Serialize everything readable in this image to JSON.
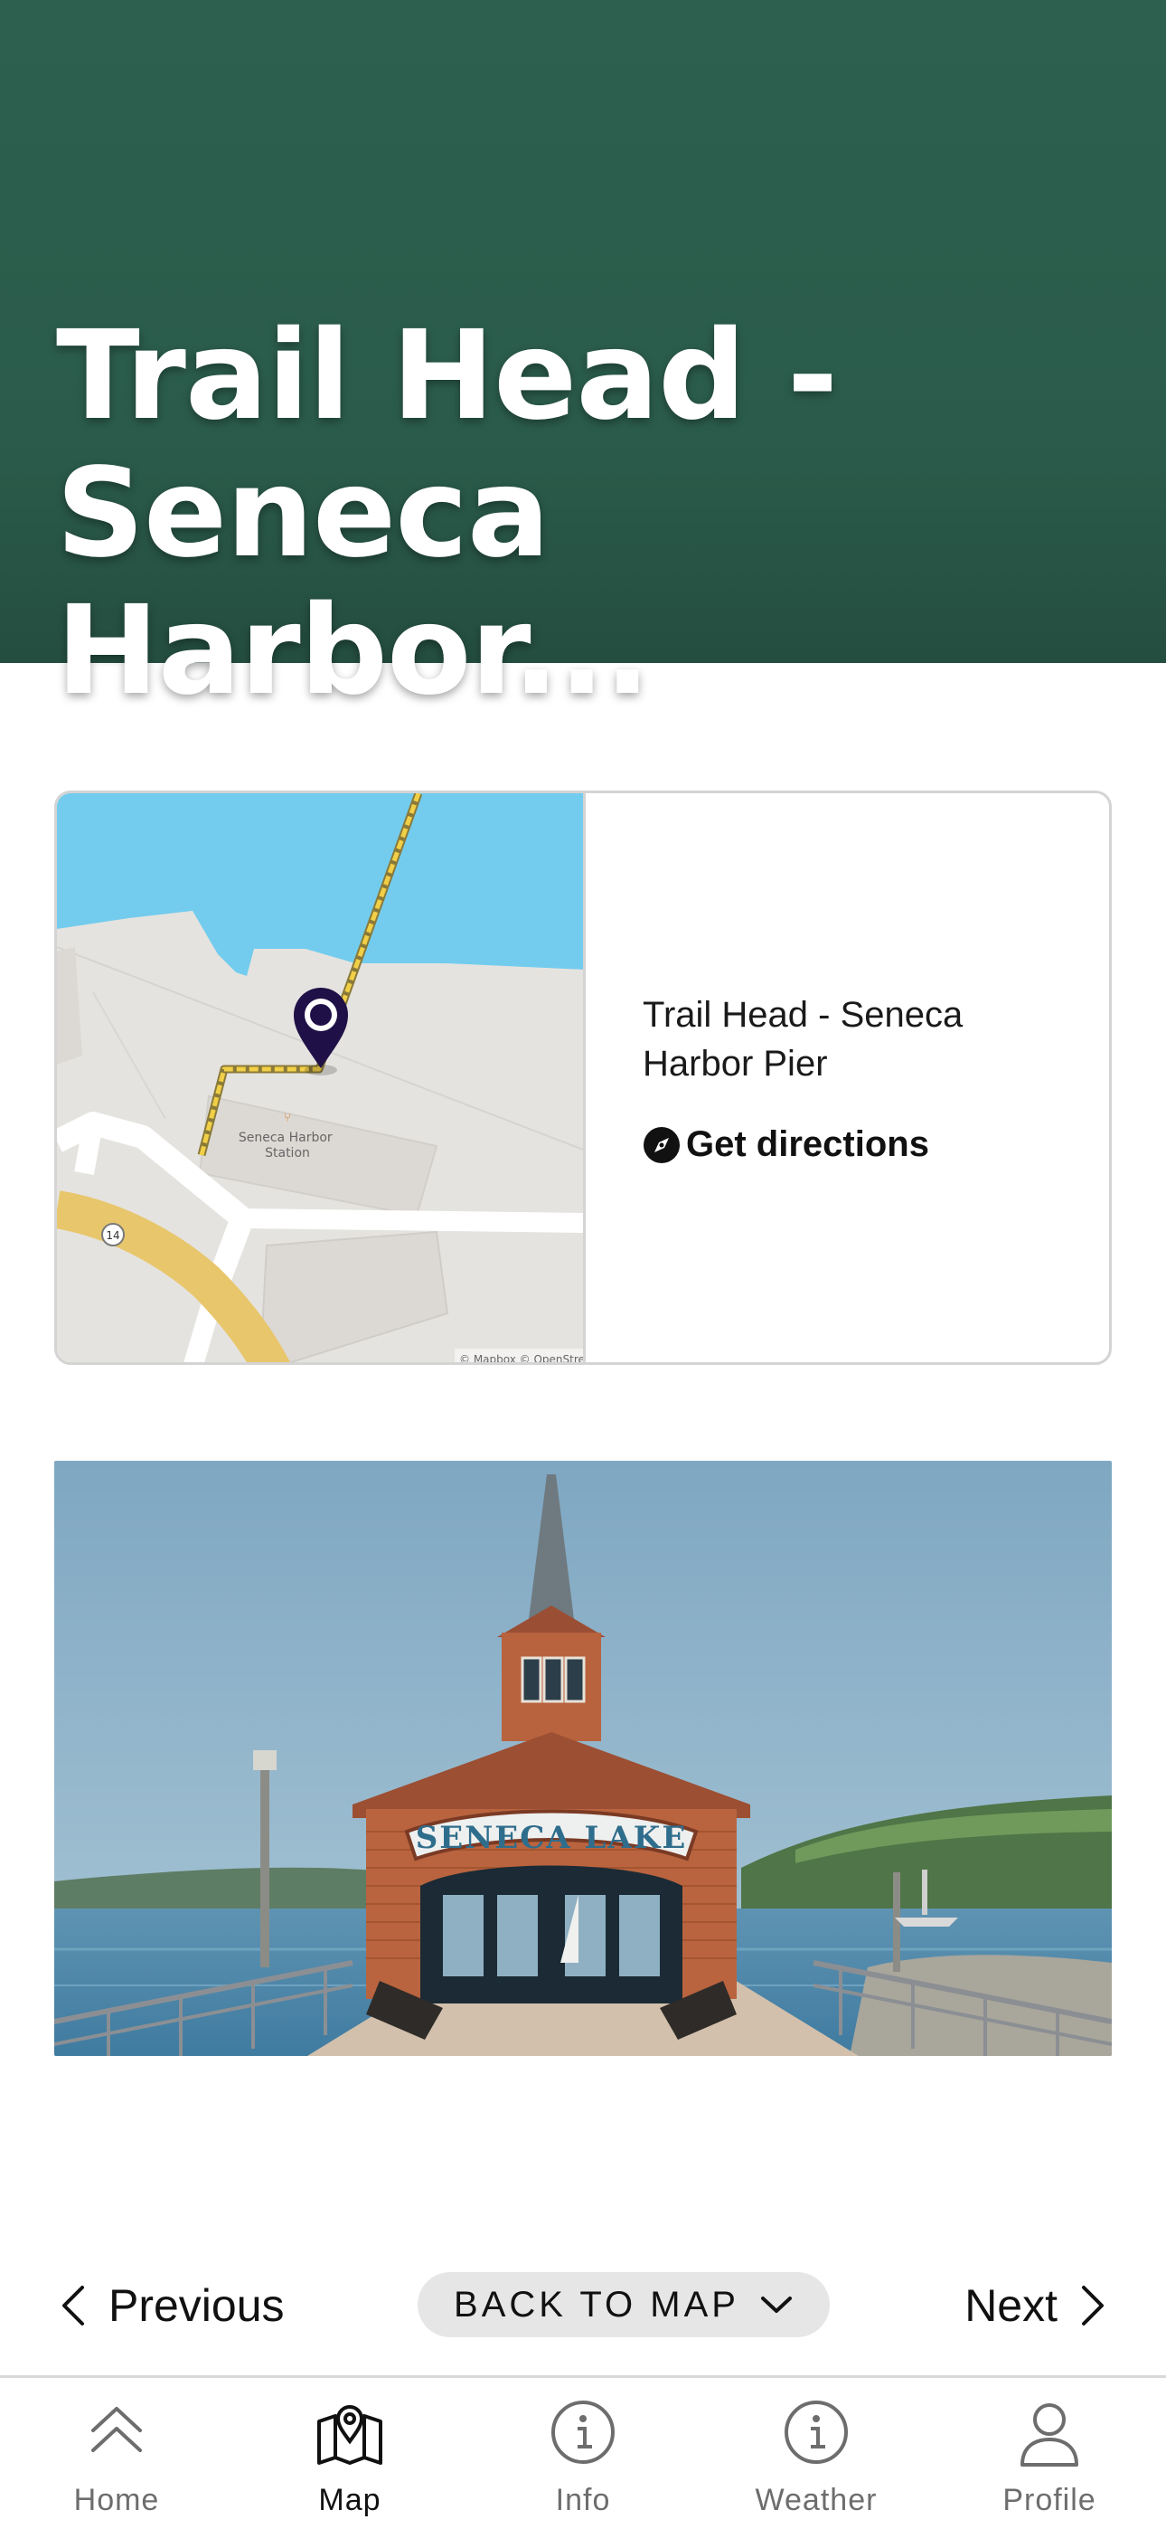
{
  "header": {
    "title": "Trail Head -\nSeneca Harbor...",
    "background_color": "#2b5c4b"
  },
  "location_card": {
    "map": {
      "poi_name": "Seneca Harbor\nStation",
      "route_shield": "14",
      "attribution": "© Mapbox © OpenStreetMap",
      "pin_color": "#1f1147"
    },
    "name": "Trail Head - Seneca Harbor Pier",
    "directions_label": "Get directions",
    "directions_icon": "compass-icon"
  },
  "photo": {
    "sign_text": "SENECA LAKE"
  },
  "pager": {
    "previous_label": "Previous",
    "back_label": "BACK TO MAP",
    "next_label": "Next"
  },
  "tabbar": {
    "tabs": [
      {
        "label": "Home",
        "icon": "chevrons-up-icon",
        "active": false
      },
      {
        "label": "Map",
        "icon": "map-pin-icon",
        "active": true
      },
      {
        "label": "Info",
        "icon": "info-icon",
        "active": false
      },
      {
        "label": "Weather",
        "icon": "info-icon",
        "active": false
      },
      {
        "label": "Profile",
        "icon": "user-icon",
        "active": false
      }
    ]
  }
}
